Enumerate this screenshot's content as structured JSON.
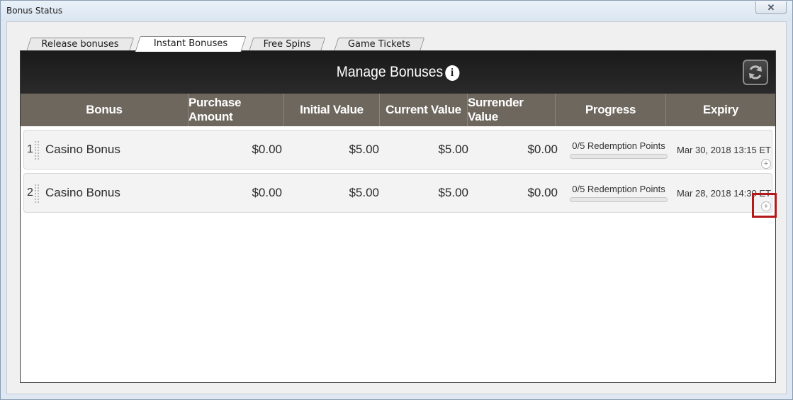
{
  "window": {
    "title": "Bonus Status",
    "close_label": "✕"
  },
  "tabs": [
    {
      "label": "Release bonuses",
      "active": false
    },
    {
      "label": "Instant Bonuses",
      "active": true
    },
    {
      "label": "Free Spins",
      "active": false
    },
    {
      "label": "Game Tickets",
      "active": false
    }
  ],
  "panel": {
    "title": "Manage Bonuses",
    "info_glyph": "i"
  },
  "columns": [
    "Bonus",
    "Purchase Amount",
    "Initial Value",
    "Current Value",
    "Surrender Value",
    "Progress",
    "Expiry"
  ],
  "rows": [
    {
      "index": "1",
      "bonus": "Casino Bonus",
      "purchase": "$0.00",
      "initial": "$5.00",
      "current": "$5.00",
      "surrender": "$0.00",
      "progress_text": "0/5 Redemption Points",
      "progress_fraction": 0,
      "expiry": "Mar 30, 2018 13:15 ET",
      "expand": "+"
    },
    {
      "index": "2",
      "bonus": "Casino Bonus",
      "purchase": "$0.00",
      "initial": "$5.00",
      "current": "$5.00",
      "surrender": "$0.00",
      "progress_text": "0/5 Redemption Points",
      "progress_fraction": 0,
      "expiry": "Mar 28, 2018 14:30 ET",
      "expand": "+"
    }
  ],
  "colors": {
    "header_bg": "#6e675e",
    "bar_bg": "#1a1a1a",
    "highlight": "#b51818"
  }
}
